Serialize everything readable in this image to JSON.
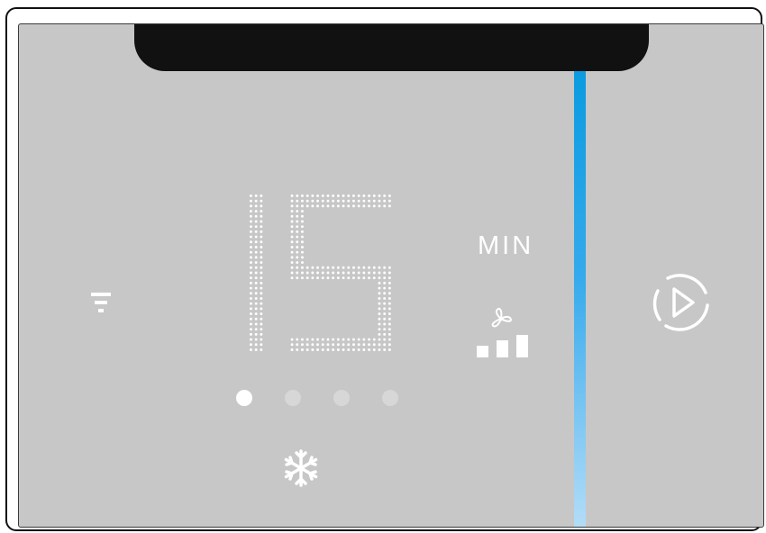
{
  "display": {
    "value": "15",
    "unit": "MIN",
    "pages": {
      "count": 4,
      "active": 1
    },
    "fan_speed_level": 3,
    "fan_speed_levels": 3
  },
  "icons": {
    "filter": "filter-icon",
    "start": "play-icon",
    "mode": "snowflake-icon",
    "fan": "fan-icon",
    "fan_speed": "fan-speed-bars-icon"
  },
  "colors": {
    "panel": "#c7c7c7",
    "notch": "#111111",
    "accent_top": "#0b9be0",
    "accent_bottom": "#b4ddf8",
    "glyph": "#ffffff"
  }
}
